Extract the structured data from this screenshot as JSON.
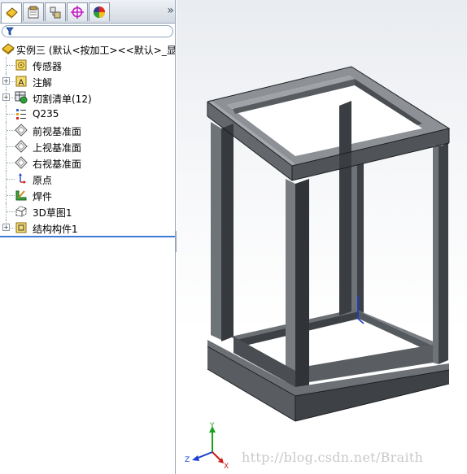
{
  "tabs": [
    {
      "name": "featuremanager",
      "icon": "featuremanager-tree-icon",
      "active": true
    },
    {
      "name": "propertymanager",
      "icon": "propertymanager-icon",
      "active": false
    },
    {
      "name": "configurationmanager",
      "icon": "configuration-icon",
      "active": false
    },
    {
      "name": "dimxpert",
      "icon": "dimxpert-crosshair-icon",
      "active": false
    },
    {
      "name": "display",
      "icon": "display-manager-icon",
      "active": false
    }
  ],
  "more_tabs": "»",
  "tree": {
    "root_label": "实例三  (默认<按加工><<默认>_显",
    "items": [
      {
        "label": "传感器",
        "icon": "sensor-icon",
        "expandable": false
      },
      {
        "label": "注解",
        "icon": "annotation-icon",
        "expandable": true
      },
      {
        "label": "切割清单(12)",
        "icon": "cut-list-icon",
        "expandable": true
      },
      {
        "label": "Q235",
        "icon": "material-icon",
        "expandable": false
      },
      {
        "label": "前视基准面",
        "icon": "plane-icon",
        "expandable": false
      },
      {
        "label": "上视基准面",
        "icon": "plane-icon",
        "expandable": false
      },
      {
        "label": "右视基准面",
        "icon": "plane-icon",
        "expandable": false
      },
      {
        "label": "原点",
        "icon": "origin-icon",
        "expandable": false
      },
      {
        "label": "焊件",
        "icon": "weldment-icon",
        "expandable": false
      },
      {
        "label": "3D草图1",
        "icon": "sketch3d-icon",
        "expandable": false
      },
      {
        "label": "结构构件1",
        "icon": "structural-member-icon",
        "expandable": true
      }
    ]
  },
  "triad": {
    "x": "X",
    "y": "Y",
    "z": "Z"
  },
  "watermark": "http://blog.csdn.net/Braith",
  "colors": {
    "frame_top": "#8d9196",
    "frame_side": "#52565b",
    "frame_dark": "#2e3134",
    "selection_line": "#3d7bd6",
    "axis_x": "#d01818",
    "axis_y": "#1aa31a",
    "axis_z": "#1a3fd0"
  }
}
